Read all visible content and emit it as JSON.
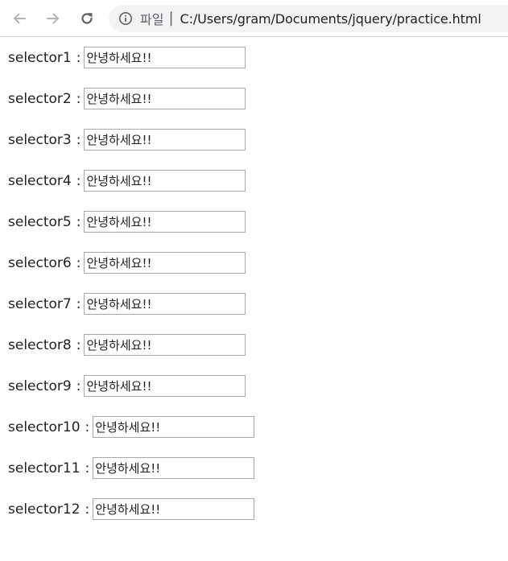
{
  "browser": {
    "back_icon": "arrow-left-icon",
    "forward_icon": "arrow-right-icon",
    "reload_icon": "reload-icon",
    "info_icon": "info-icon",
    "scheme_label": "파일",
    "separator": "|",
    "url": "C:/Users/gram/Documents/jquery/practice.html"
  },
  "rows": [
    {
      "label": "selector1",
      "colon": ":",
      "value": "안녕하세요!!"
    },
    {
      "label": "selector2",
      "colon": ":",
      "value": "안녕하세요!!"
    },
    {
      "label": "selector3",
      "colon": ":",
      "value": "안녕하세요!!"
    },
    {
      "label": "selector4",
      "colon": ":",
      "value": "안녕하세요!!"
    },
    {
      "label": "selector5",
      "colon": ":",
      "value": "안녕하세요!!"
    },
    {
      "label": "selector6",
      "colon": ":",
      "value": "안녕하세요!!"
    },
    {
      "label": "selector7",
      "colon": ":",
      "value": "안녕하세요!!"
    },
    {
      "label": "selector8",
      "colon": ":",
      "value": "안녕하세요!!"
    },
    {
      "label": "selector9",
      "colon": ":",
      "value": "안녕하세요!!"
    },
    {
      "label": "selector10",
      "colon": ":",
      "value": "안녕하세요!!"
    },
    {
      "label": "selector11",
      "colon": ":",
      "value": "안녕하세요!!"
    },
    {
      "label": "selector12",
      "colon": ":",
      "value": "안녕하세요!!"
    }
  ]
}
